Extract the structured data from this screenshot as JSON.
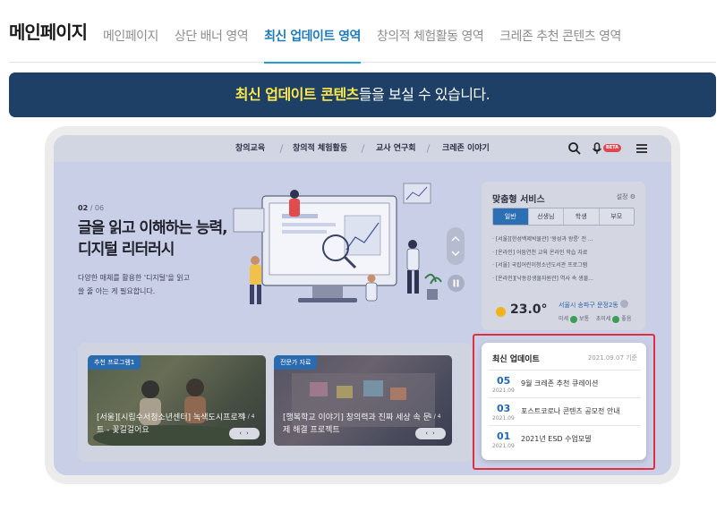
{
  "top_tabs": {
    "title": "메인페이지",
    "tabs": [
      {
        "label": "메인페이지",
        "active": false
      },
      {
        "label": "상단 배너 영역",
        "active": false
      },
      {
        "label": "최신 업데이트 영역",
        "active": true
      },
      {
        "label": "창의적 체험활동 영역",
        "active": false
      },
      {
        "label": "크레존 추천 콘텐츠 영역",
        "active": false
      }
    ]
  },
  "notice": {
    "highlight": "최신 업데이트 콘텐츠",
    "rest": "들을 보실 수 있습니다."
  },
  "site": {
    "gnb": [
      "창의교육",
      "창의적 체험활동",
      "교사 연구회",
      "크레존 이야기"
    ],
    "beta_label": "BETA",
    "icons": [
      "search-icon",
      "mic-icon",
      "menu-icon"
    ],
    "hero": {
      "current": "02",
      "total": "/ 06",
      "title_line1": "글을 읽고 이해하는 능력,",
      "title_line2": "디지털 리터러시",
      "desc_line1": "다양한 매체를 활용한 '디지털'을 읽고",
      "desc_line2": "쓸 줄 아는 게 필요합니다."
    },
    "service": {
      "title": "맞춤형 서비스",
      "setting": "설정",
      "tabs": [
        "일반",
        "선생님",
        "학생",
        "부모"
      ],
      "active_tab": 0,
      "items": [
        "· [서울][한성백제박물관] '왕성과 왕릉' 전 ...",
        "· [온라인] 어둠연천 교육 온라인 학습 자료",
        "· [서울] 국립어린이청소년도서관 프로그램",
        "· [온라인][낙동강생물자원관] 역사 속 생물..."
      ],
      "weather": {
        "temp": "23.0°",
        "location": "서울시 송파구 문정2동",
        "fine_dust_label": "미세",
        "fine_dust_value": "보통",
        "ultra_dust_label": "초미세",
        "ultra_dust_value": "좋음"
      }
    },
    "cards": [
      {
        "badge": "추천 프로그램1",
        "text": "[서울][시립수서청소년센터] 녹색도시프로젝트 - 꽃길걸어요",
        "page": "1 / 4"
      },
      {
        "badge": "전문가 자료",
        "text": "[행복학교 이야기] 창의력과 진짜 세상 속 문제 해결 프로젝트",
        "page": "1 / 4"
      }
    ],
    "updates": {
      "title": "최신 업데이트",
      "date": "2021.09.07 기준",
      "items": [
        {
          "day": "05",
          "ym": "2021.09",
          "text": "9월 크레존 추천 큐레이션"
        },
        {
          "day": "03",
          "ym": "2021.09",
          "text": "포스트코로나 콘텐츠 공모전 안내"
        },
        {
          "day": "01",
          "ym": "2021.09",
          "text": "2021년 ESD 수업모델"
        }
      ]
    }
  },
  "colors": {
    "accent": "#1f7bb8",
    "notice_bg": "#1e4066",
    "notice_highlight": "#ffe84a",
    "highlight_border": "#e0303e",
    "update_day": "#2468b0"
  }
}
